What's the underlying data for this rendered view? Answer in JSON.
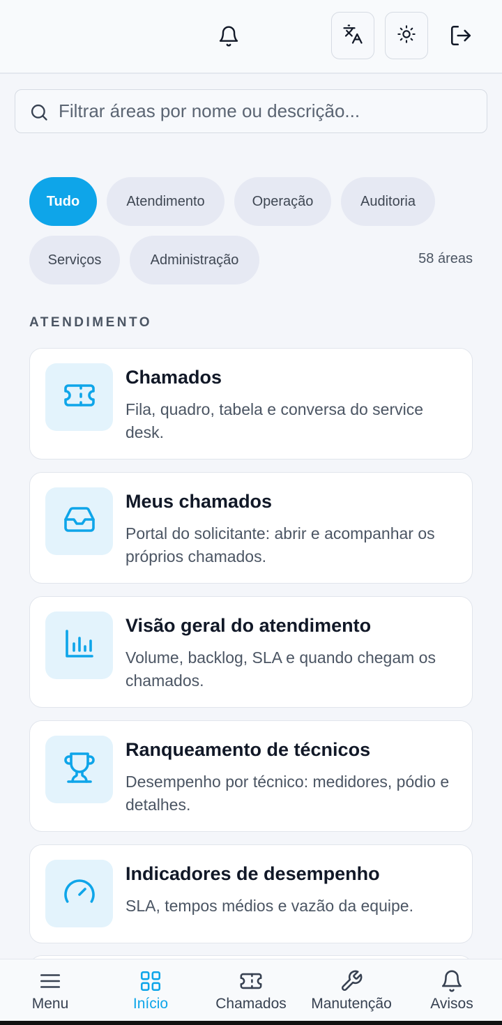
{
  "header": {
    "notifications_icon": "bell-icon",
    "translate_icon": "translate-icon",
    "theme_icon": "sun-icon",
    "logout_icon": "logout-icon"
  },
  "search": {
    "placeholder": "Filtrar áreas por nome ou descrição...",
    "value": ""
  },
  "filters": {
    "chips": [
      "Tudo",
      "Atendimento",
      "Operação",
      "Auditoria",
      "Serviços",
      "Administração"
    ],
    "active": "Tudo",
    "count_label": "58 áreas"
  },
  "section": {
    "title": "ATENDIMENTO"
  },
  "cards": [
    {
      "icon": "ticket-icon",
      "title": "Chamados",
      "description": "Fila, quadro, tabela e conversa do service desk."
    },
    {
      "icon": "inbox-icon",
      "title": "Meus chamados",
      "description": "Portal do solicitante: abrir e acompanhar os próprios chamados."
    },
    {
      "icon": "bar-chart-icon",
      "title": "Visão geral do atendimento",
      "description": "Volume, backlog, SLA e quando chegam os chamados."
    },
    {
      "icon": "trophy-icon",
      "title": "Ranqueamento de técnicos",
      "description": "Desempenho por técnico: medidores, pódio e detalhes."
    },
    {
      "icon": "gauge-icon",
      "title": "Indicadores de desempenho",
      "description": "SLA, tempos médios e vazão da equipe."
    }
  ],
  "bottom_nav": {
    "items": [
      {
        "label": "Menu",
        "icon": "menu-icon"
      },
      {
        "label": "Início",
        "icon": "grid-icon"
      },
      {
        "label": "Chamados",
        "icon": "ticket-icon"
      },
      {
        "label": "Manutenção",
        "icon": "wrench-icon"
      },
      {
        "label": "Avisos",
        "icon": "bell-icon"
      }
    ],
    "active": "Início"
  },
  "colors": {
    "accent": "#0ea5e9",
    "icon_bg": "#e3f3fc",
    "chip_bg": "#e6e9f3",
    "page_bg": "#f4f6fa"
  }
}
